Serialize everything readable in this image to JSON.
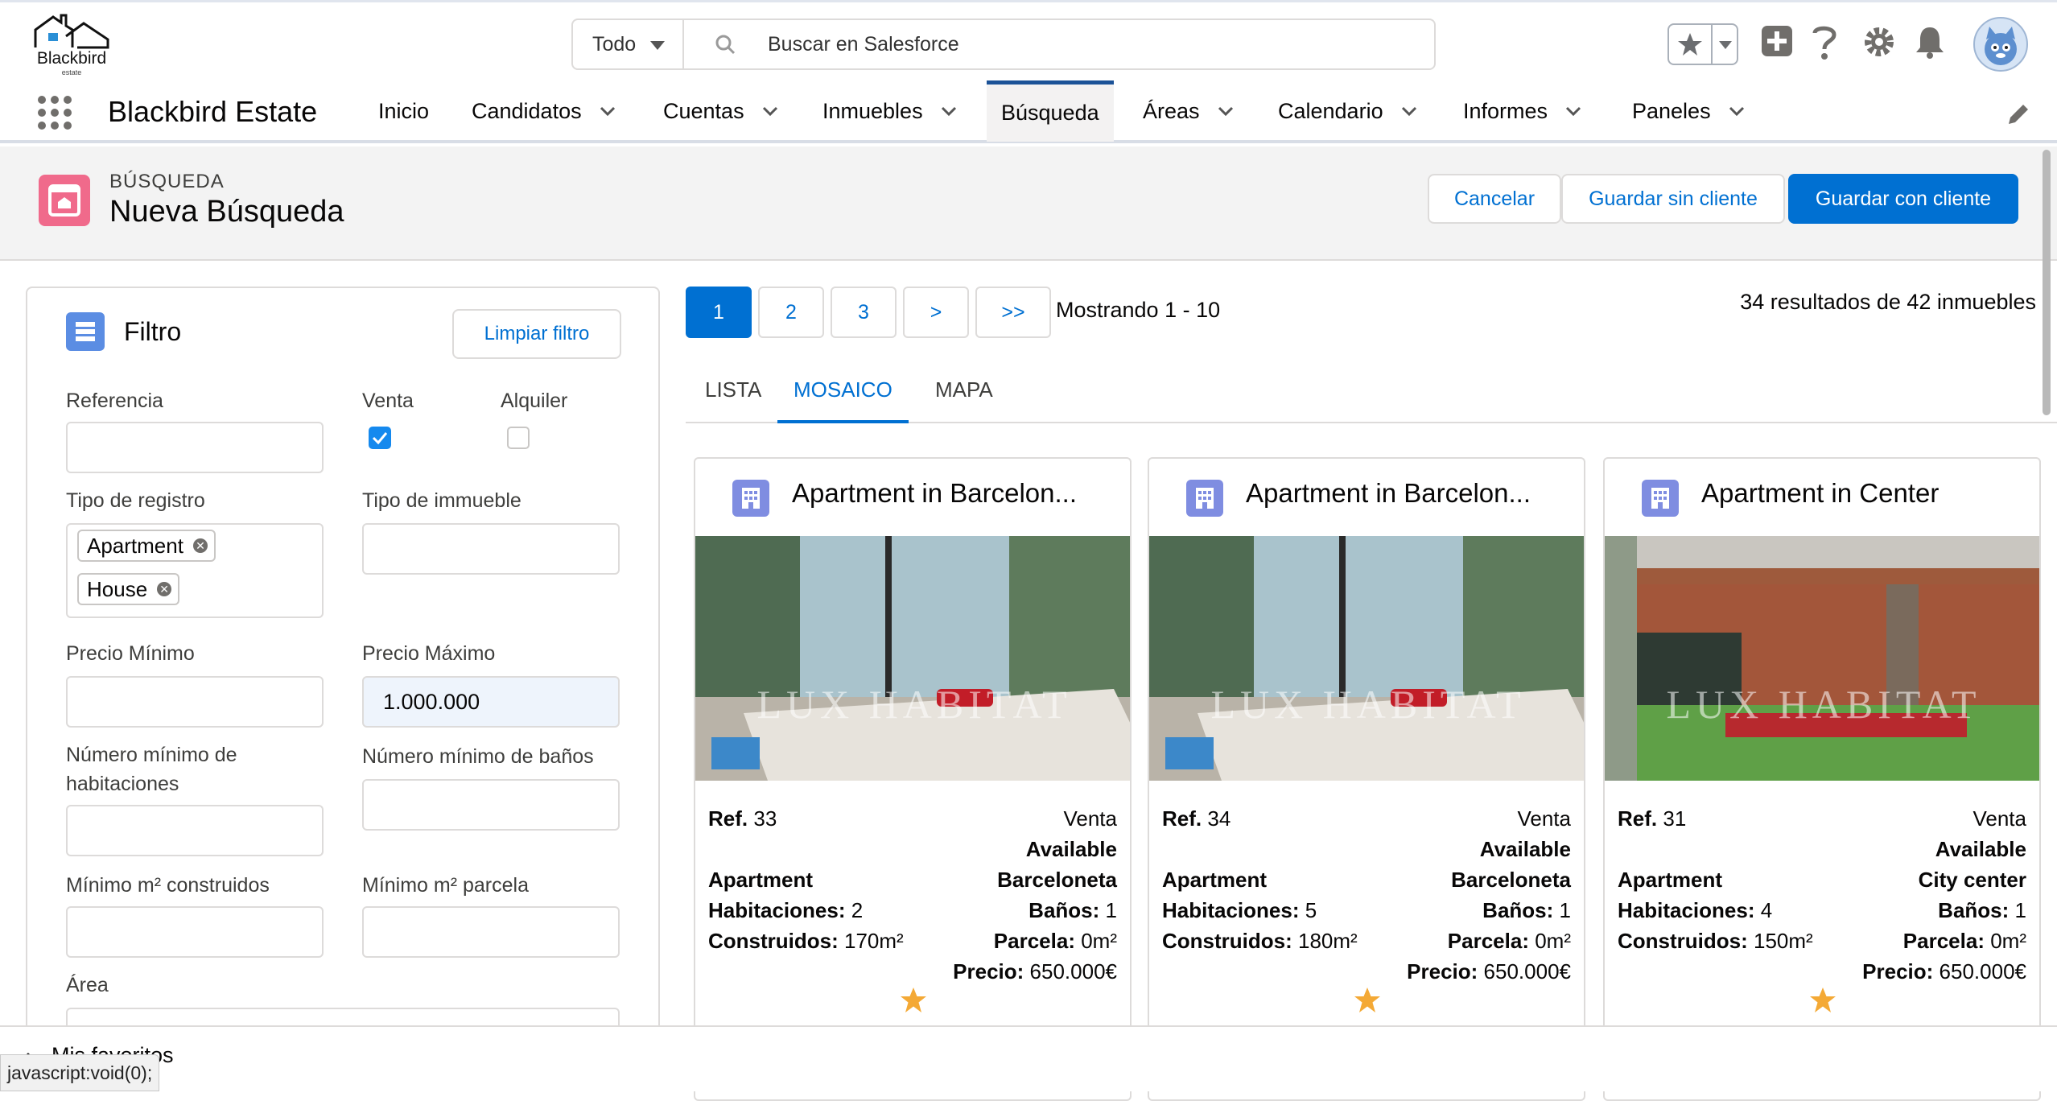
{
  "header": {
    "logo_text": "Blackbird",
    "logo_sub": "estate",
    "search_scope": "Todo",
    "search_placeholder": "Buscar en Salesforce"
  },
  "nav": {
    "app_name": "Blackbird Estate",
    "items": [
      {
        "label": "Inicio",
        "has_menu": false
      },
      {
        "label": "Candidatos",
        "has_menu": true
      },
      {
        "label": "Cuentas",
        "has_menu": true
      },
      {
        "label": "Inmuebles",
        "has_menu": true
      },
      {
        "label": "Búsqueda",
        "has_menu": false,
        "active": true
      },
      {
        "label": "Áreas",
        "has_menu": true
      },
      {
        "label": "Calendario",
        "has_menu": true
      },
      {
        "label": "Informes",
        "has_menu": true
      },
      {
        "label": "Paneles",
        "has_menu": true
      }
    ]
  },
  "page": {
    "eyebrow": "BÚSQUEDA",
    "title": "Nueva Búsqueda",
    "buttons": {
      "cancel": "Cancelar",
      "save_no_client": "Guardar sin cliente",
      "save_client": "Guardar con cliente"
    }
  },
  "filter": {
    "title": "Filtro",
    "clear": "Limpiar filtro",
    "referencia": "Referencia",
    "venta": "Venta",
    "alquiler": "Alquiler",
    "venta_checked": true,
    "alquiler_checked": false,
    "tipo_registro": "Tipo de registro",
    "tipo_registro_values": [
      "Apartment",
      "House"
    ],
    "tipo_inmueble": "Tipo de immueble",
    "precio_min": "Precio Mínimo",
    "precio_max": "Precio Máximo",
    "precio_max_value": "1.000.000",
    "hab_label_1": "Número mínimo de",
    "hab_label_2": "habitaciones",
    "banos": "Número mínimo de baños",
    "m2_const": "Mínimo m² construidos",
    "m2_parcela": "Mínimo m² parcela",
    "area": "Área"
  },
  "pagination": {
    "pages": [
      "1",
      "2",
      "3",
      ">",
      ">>"
    ],
    "current": "1",
    "showing": "Mostrando 1 - 10",
    "count": "34 resultados de 42 inmuebles"
  },
  "tabs": [
    "LISTA",
    "MOSAICO",
    "MAPA"
  ],
  "active_tab": "MOSAICO",
  "cards": [
    {
      "title": "Apartment in Barcelon...",
      "watermark": "LUX HABITAT",
      "ref_label": "Ref.",
      "ref": "33",
      "operation": "Venta",
      "status": "Available",
      "type": "Apartment",
      "zone": "Barceloneta",
      "hab_label": "Habitaciones:",
      "hab": "2",
      "banos_label": "Baños:",
      "banos": "1",
      "const_label": "Construidos:",
      "const": "170m²",
      "parcela_label": "Parcela:",
      "parcela": "0m²",
      "precio_label": "Precio:",
      "precio": "650.000€",
      "photo": "interior"
    },
    {
      "title": "Apartment in Barcelon...",
      "watermark": "LUX HABITAT",
      "ref_label": "Ref.",
      "ref": "34",
      "operation": "Venta",
      "status": "Available",
      "type": "Apartment",
      "zone": "Barceloneta",
      "hab_label": "Habitaciones:",
      "hab": "5",
      "banos_label": "Baños:",
      "banos": "1",
      "const_label": "Construidos:",
      "const": "180m²",
      "parcela_label": "Parcela:",
      "parcela": "0m²",
      "precio_label": "Precio:",
      "precio": "650.000€",
      "photo": "interior"
    },
    {
      "title": "Apartment in Center",
      "watermark": "LUX HABITAT",
      "ref_label": "Ref.",
      "ref": "31",
      "operation": "Venta",
      "status": "Available",
      "type": "Apartment",
      "zone": "City center",
      "hab_label": "Habitaciones:",
      "hab": "4",
      "banos_label": "Baños:",
      "banos": "1",
      "const_label": "Construidos:",
      "const": "150m²",
      "parcela_label": "Parcela:",
      "parcela": "0m²",
      "precio_label": "Precio:",
      "precio": "650.000€",
      "photo": "exterior"
    }
  ],
  "utility": {
    "favorites": "Mis favoritos",
    "status_url": "javascript:void(0);"
  },
  "colors": {
    "brand": "#0070d2",
    "object_icon": "#f06a8b",
    "card_icon": "#7f8de1",
    "star": "#f4a935"
  }
}
